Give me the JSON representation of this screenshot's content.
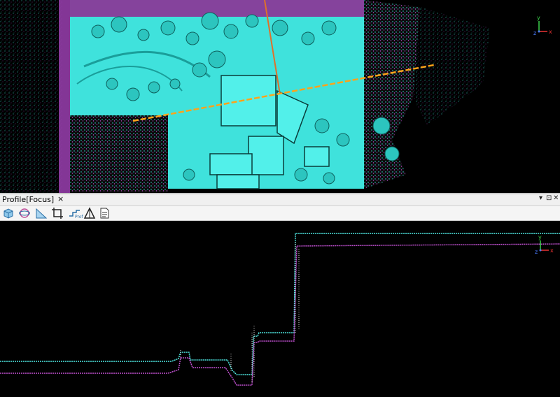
{
  "panel": {
    "title": "Profile[Focus]",
    "close_glyph": "×",
    "pin_glyph": "▾",
    "float_glyph": "⊡",
    "close_window_glyph": "✕"
  },
  "toolbar": {
    "items": [
      {
        "name": "view-3d-icon"
      },
      {
        "name": "orbit-icon"
      },
      {
        "name": "slope-icon"
      },
      {
        "name": "crop-select-icon"
      },
      {
        "name": "section-profile-icon",
        "text": "Prof"
      },
      {
        "name": "measure-triangle-icon"
      },
      {
        "name": "report-icon"
      }
    ]
  },
  "axis": {
    "x": "x",
    "y": "y",
    "z": "z"
  },
  "colors": {
    "ground": "#39e6e0",
    "ground_dark": "#1a9e9a",
    "vegetation": "#c84cd8",
    "section_line": "#ffa31a",
    "focus_line": "#e0702a",
    "profile_top": "#4fe8e2",
    "profile_bottom": "#c050d0",
    "panel_bg": "#f0f0f0"
  }
}
